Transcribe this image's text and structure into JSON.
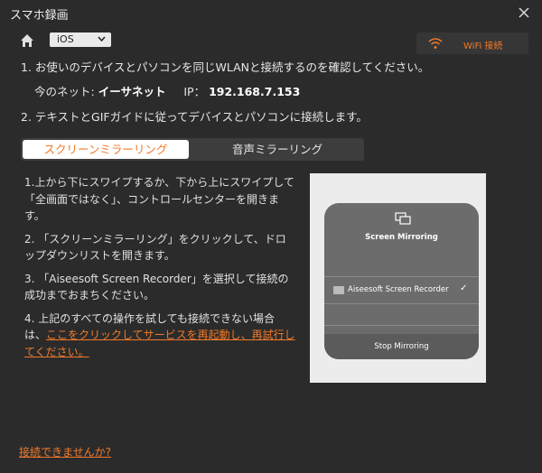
{
  "window": {
    "title": "スマホ録画"
  },
  "toolbar": {
    "os_selected": "iOS",
    "wifi_tab_label": "WiFi 接続"
  },
  "steps": {
    "step1": "1. お使いのデバイスとパソコンを同じWLANと接続するのを確認してください。",
    "network_label": "今のネット:",
    "network_value": "イーサネット",
    "ip_label": "IP：",
    "ip_value": "192.168.7.153",
    "step2": "2. テキストとGIFガイドに従ってデバイスとパソコンに接続します。"
  },
  "tabs": {
    "screen_mirroring": "スクリーンミラーリング",
    "audio_mirroring": "音声ミラーリング"
  },
  "instructions": {
    "i1": "1.上から下にスワイプするか、下から上にスワイプして「全画面ではなく」、コントロールセンターを開きます。",
    "i2": "2. 「スクリーンミラーリング」をクリックして、ドロップダウンリストを開きます。",
    "i3": "3. 「Aiseesoft Screen Recorder」を選択して接続の成功までおまちください。",
    "i4_prefix": "4. 上記のすべての操作を試しても接続できない場合は、",
    "i4_link": "ここをクリックしてサービスを再起動し、再試行してください。"
  },
  "preview": {
    "heading": "Screen Mirroring",
    "device_name": "Aiseesoft Screen Recorder",
    "check": "✓",
    "stop": "Stop Mirroring"
  },
  "footer": {
    "cant_connect": "接続できませんか?"
  },
  "colors": {
    "accent": "#f07a2a",
    "background": "#2b2b2b"
  }
}
